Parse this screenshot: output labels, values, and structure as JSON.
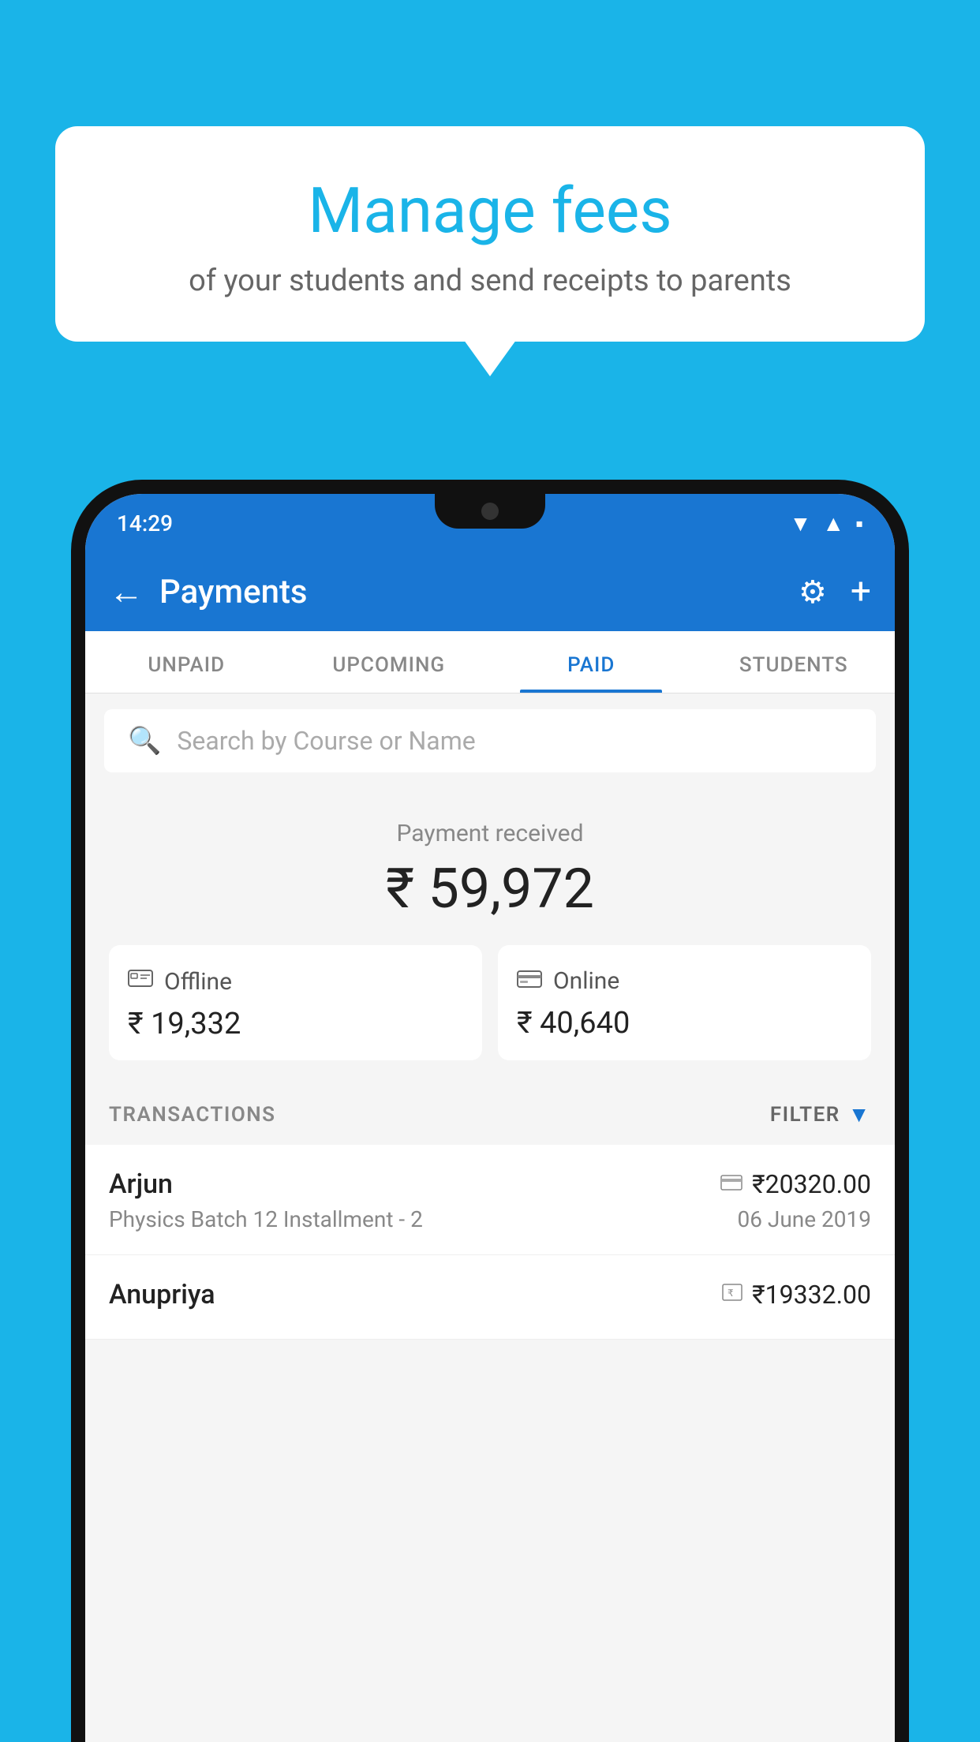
{
  "background": {
    "color": "#1ab4e8"
  },
  "tooltip": {
    "title": "Manage fees",
    "subtitle": "of your students and send receipts to parents"
  },
  "status_bar": {
    "time": "14:29",
    "wifi": "▲",
    "signal": "▲",
    "battery": "▪"
  },
  "header": {
    "title": "Payments",
    "back_label": "←",
    "gear_label": "⚙",
    "plus_label": "+"
  },
  "tabs": [
    {
      "label": "UNPAID",
      "active": false
    },
    {
      "label": "UPCOMING",
      "active": false
    },
    {
      "label": "PAID",
      "active": true
    },
    {
      "label": "STUDENTS",
      "active": false
    }
  ],
  "search": {
    "placeholder": "Search by Course or Name"
  },
  "payment_summary": {
    "received_label": "Payment received",
    "amount": "₹ 59,972",
    "offline_label": "Offline",
    "offline_amount": "₹ 19,332",
    "online_label": "Online",
    "online_amount": "₹ 40,640"
  },
  "transactions": {
    "header_label": "TRANSACTIONS",
    "filter_label": "FILTER",
    "rows": [
      {
        "name": "Arjun",
        "amount": "₹20320.00",
        "course": "Physics Batch 12 Installment - 2",
        "date": "06 June 2019",
        "icon_type": "card"
      },
      {
        "name": "Anupriya",
        "amount": "₹19332.00",
        "course": "",
        "date": "",
        "icon_type": "cash"
      }
    ]
  }
}
